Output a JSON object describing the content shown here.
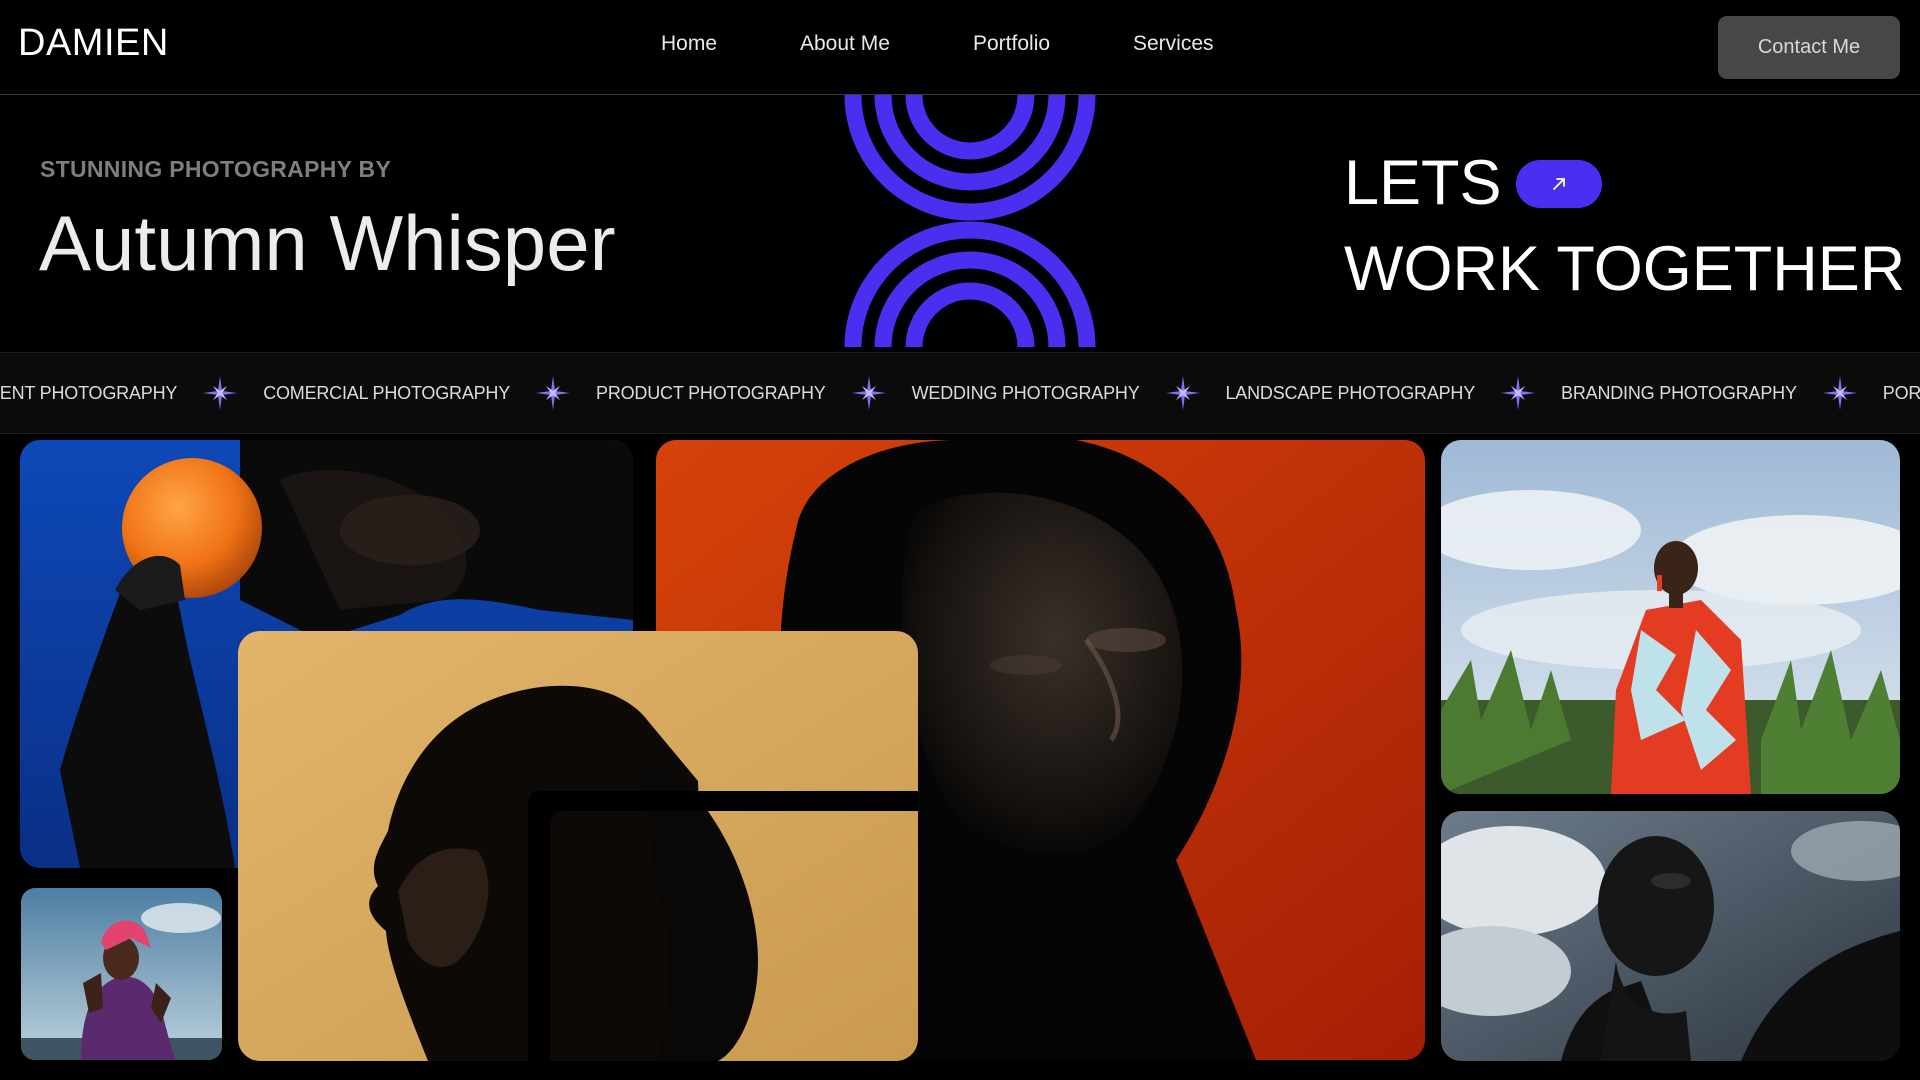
{
  "nav": {
    "brand": "DAMIEN",
    "links": [
      {
        "label": "Home"
      },
      {
        "label": "About Me"
      },
      {
        "label": "Portfolio"
      },
      {
        "label": "Services"
      }
    ],
    "contact_label": "Contact Me"
  },
  "hero": {
    "eyebrow": "STUNNING PHOTOGRAPHY BY",
    "name": "Autumn Whisper",
    "cta_line1": "LETS",
    "cta_line2": "WORK TOGETHER",
    "cta_icon": "arrow-up-right-icon"
  },
  "marquee": {
    "separator_icon": "sparkle-star-icon",
    "items": [
      "VENT PHOTOGRAPHY",
      "COMERCIAL PHOTOGRAPHY",
      "PRODUCT PHOTOGRAPHY",
      "WEDDING PHOTOGRAPHY",
      "LANDSCAPE PHOTOGRAPHY",
      "BRANDING PHOTOGRAPHY",
      "PORTRAIT PHOTOG"
    ]
  },
  "colors": {
    "background": "#000000",
    "accent": "#4a2ff0",
    "contact_button": "#474747",
    "muted_text": "#7e7e7e"
  },
  "gallery": [
    {
      "subject": "portrait-orange-blue"
    },
    {
      "subject": "portrait-red-backdrop"
    },
    {
      "subject": "portrait-cornfield"
    },
    {
      "subject": "profile-yellow-backdrop"
    },
    {
      "subject": "portrait-pink-headscarf"
    },
    {
      "subject": "portrait-clouds-monochrome"
    }
  ]
}
